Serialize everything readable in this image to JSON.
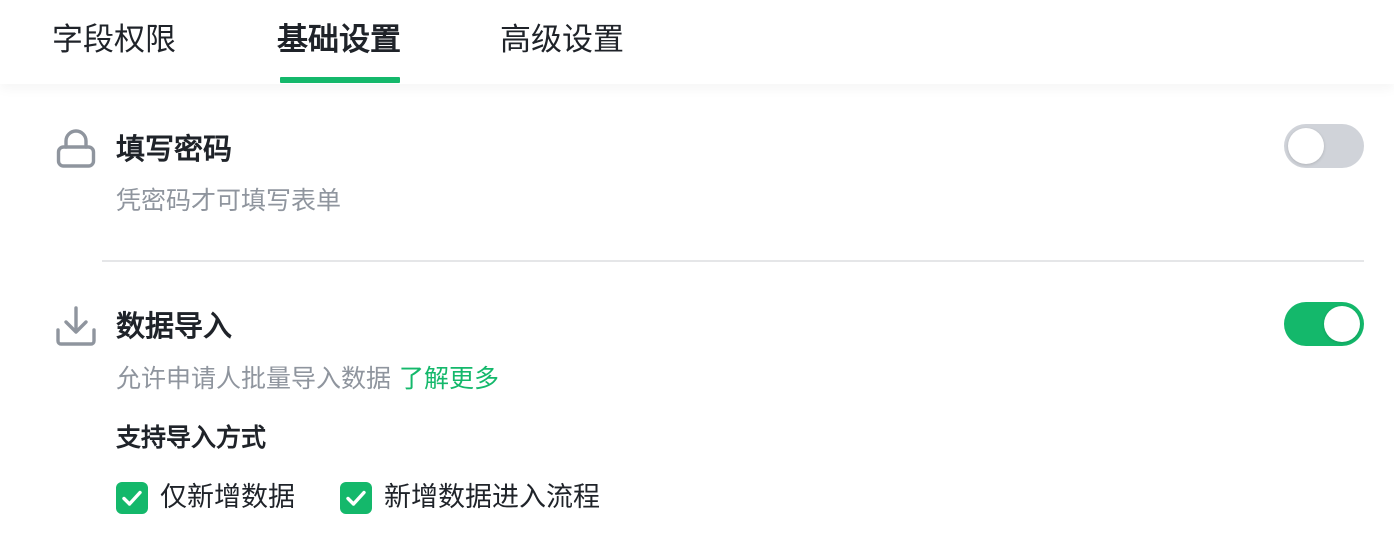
{
  "tabs": [
    {
      "label": "字段权限",
      "active": false
    },
    {
      "label": "基础设置",
      "active": true
    },
    {
      "label": "高级设置",
      "active": false
    }
  ],
  "password_setting": {
    "icon": "lock-icon",
    "title": "填写密码",
    "description": "凭密码才可填写表单",
    "enabled": false
  },
  "data_import_setting": {
    "icon": "download-icon",
    "title": "数据导入",
    "description": "允许申请人批量导入数据",
    "learn_more": "了解更多",
    "enabled": true,
    "methods_heading": "支持导入方式",
    "methods": [
      {
        "label": "仅新增数据",
        "checked": true
      },
      {
        "label": "新增数据进入流程",
        "checked": true
      }
    ]
  },
  "colors": {
    "accent": "#14b86b",
    "toggle_off": "#d0d3d9",
    "text_primary": "#1f2329",
    "text_secondary": "#8f959e"
  }
}
